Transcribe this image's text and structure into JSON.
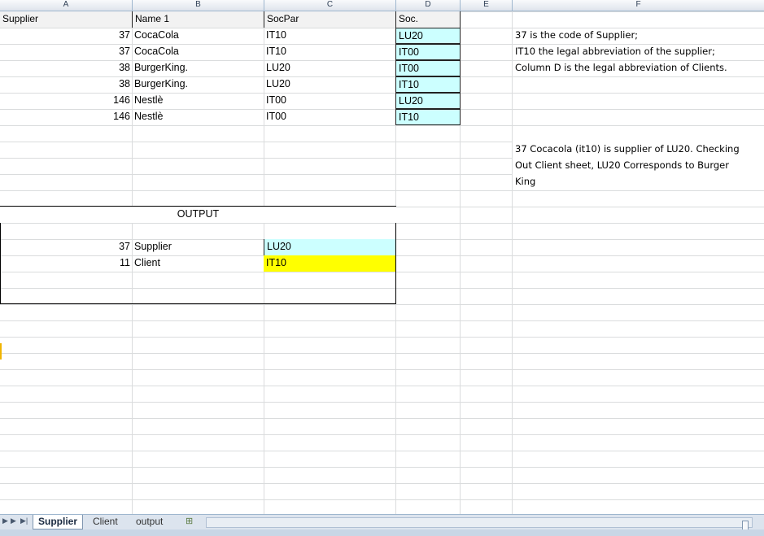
{
  "columns": [
    "A",
    "B",
    "C",
    "D",
    "E",
    "F"
  ],
  "header_row": {
    "a": "Supplier",
    "b": "Name 1",
    "c": "SocPar",
    "d": "Soc."
  },
  "rows": [
    {
      "a": "37",
      "b": "CocaCola",
      "c": "IT10",
      "d": "LU20"
    },
    {
      "a": "37",
      "b": "CocaCola",
      "c": "IT10",
      "d": "IT00"
    },
    {
      "a": "38",
      "b": "BurgerKing.",
      "c": "LU20",
      "d": "IT00"
    },
    {
      "a": "38",
      "b": "BurgerKing.",
      "c": "LU20",
      "d": "IT10"
    },
    {
      "a": "146",
      "b": "Nestlè",
      "c": "IT00",
      "d": "LU20"
    },
    {
      "a": "146",
      "b": "Nestlè",
      "c": "IT00",
      "d": "IT10"
    }
  ],
  "notes": [
    "37 is the code of Supplier;",
    "IT10 the legal abbreviation of the supplier;",
    "Column D is the legal abbreviation of Clients."
  ],
  "example_lines": [
    "37 Cocacola (it10) is supplier of LU20. Checking",
    "Out Client sheet, LU20 Corresponds to Burger",
    "King"
  ],
  "output": {
    "title": "OUTPUT",
    "supplier_num": "37",
    "supplier_label": "Supplier",
    "supplier_value": "LU20",
    "client_num": "11",
    "client_label": "Client",
    "client_value": "IT10"
  },
  "sheet_tabs": [
    "Supplier",
    "Client",
    "output"
  ],
  "active_tab": "Supplier",
  "colors": {
    "cyan_fill": "#ccffff",
    "yellow_fill": "#ffff00",
    "grid_line": "#dadcdd"
  }
}
